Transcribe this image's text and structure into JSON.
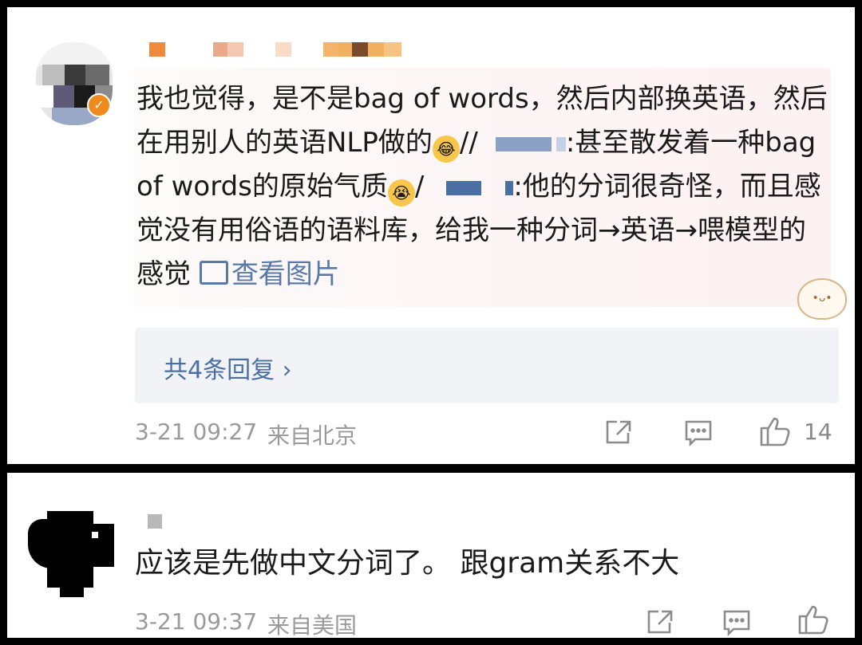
{
  "comments": [
    {
      "text": {
        "part1": "我也觉得，是不是bag of words，然后内部换英语，然后在用别人的英语NLP做的",
        "sep1": "//",
        "tail1": ":甚至散发着一种bag of words的原始气质",
        "sep2": "/",
        "tail2": ":他的分词很奇怪，而且感觉没有用俗语的语料库，给我一种分词→英语→喂模型的感觉 ",
        "view_image": "查看图片"
      },
      "replies_label": "共4条回复 ›",
      "time": "3-21 09:27",
      "location": "来自北京",
      "likes": "14"
    },
    {
      "text": "应该是先做中文分词了。 跟gram关系不大",
      "time": "3-21 09:37",
      "location": "来自美国"
    }
  ],
  "icons": {
    "share": "share-icon",
    "comment": "comment-icon",
    "like": "thumbs-up-icon"
  },
  "colors": {
    "link": "#4a6fa5",
    "meta": "#9a9a9a",
    "text": "#1a1a1a"
  }
}
